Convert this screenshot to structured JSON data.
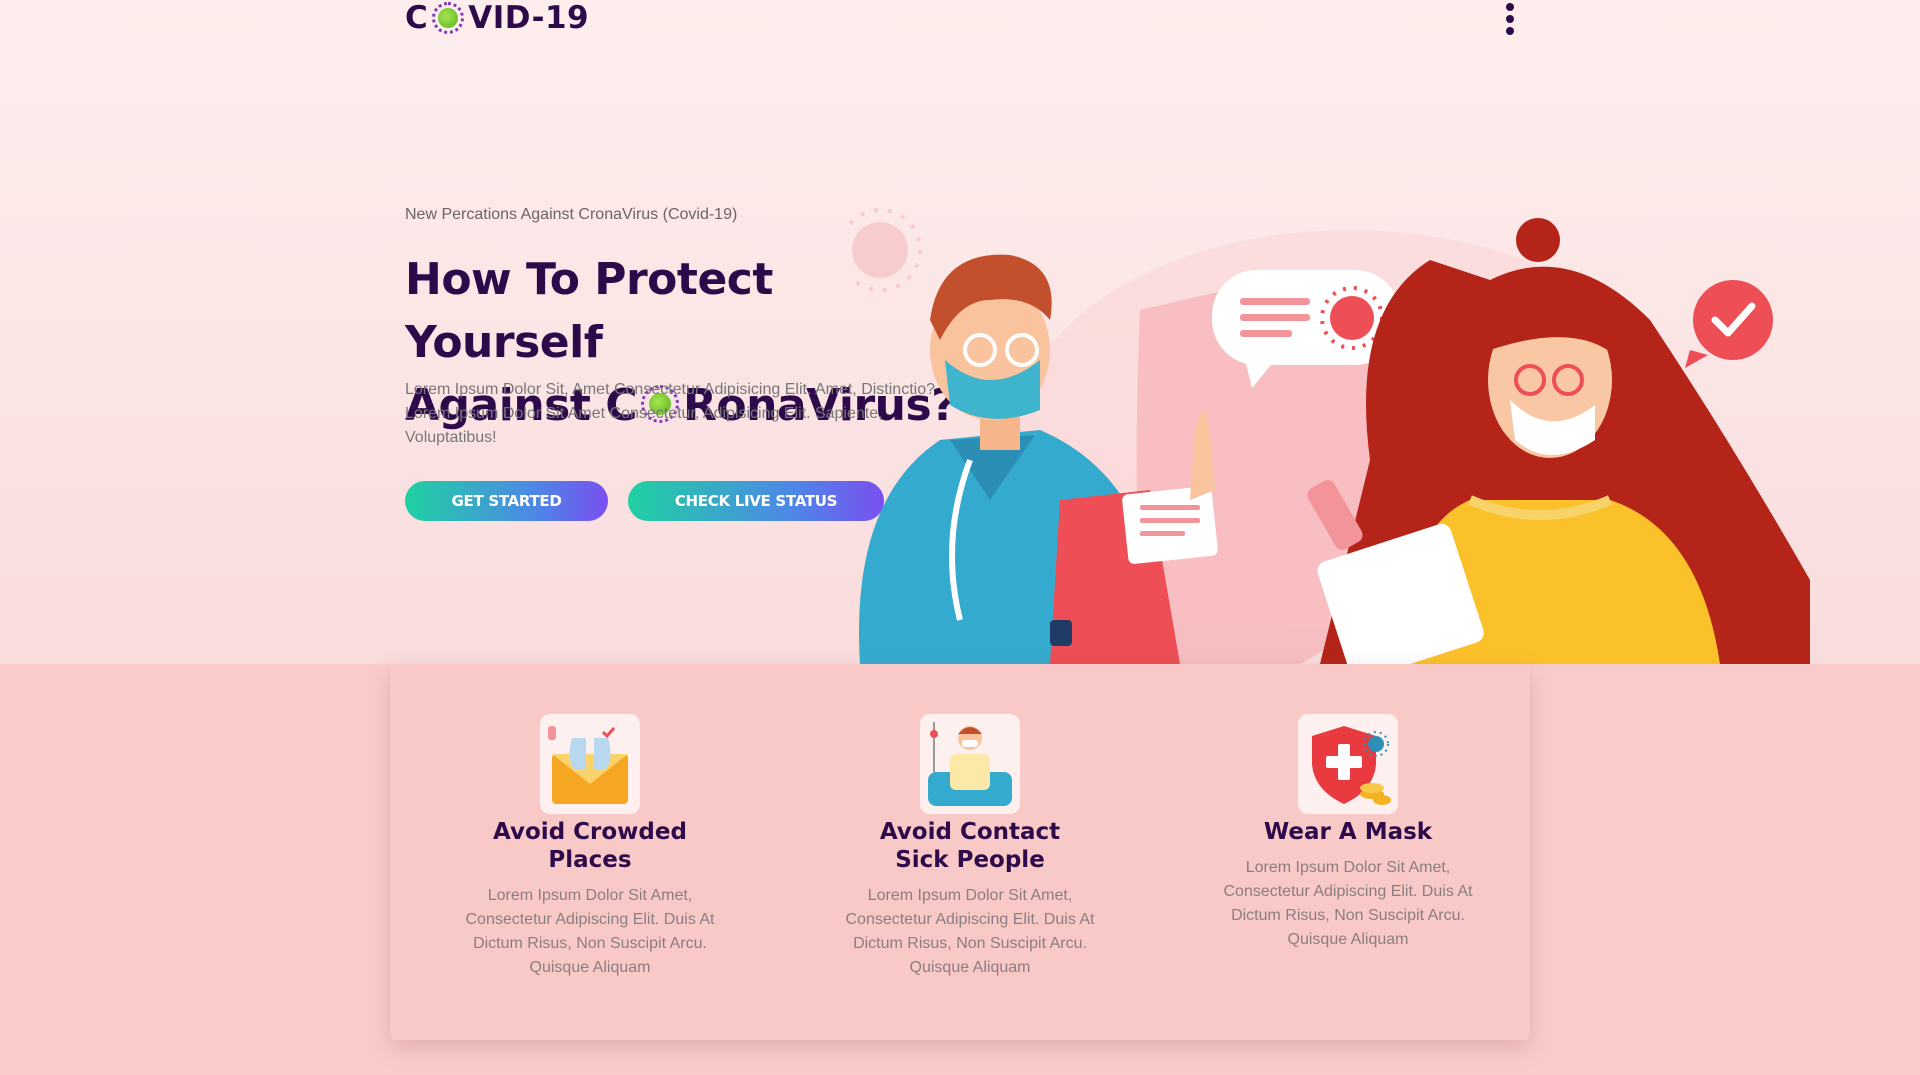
{
  "brand": {
    "logo_left": "C",
    "logo_right": "VID-19"
  },
  "hero": {
    "subtitle": "New Percations Against CronaVirus (Covid-19)",
    "title_line1": "How To Protect Yourself",
    "title_line2_left": "Against C",
    "title_line2_right": "RonaVirus?",
    "description": "Lorem Ipsum Dolor Sit, Amet Consectetur Adipisicing Elit. Amet, Distinctio? Lorem Ipsum Dolor Sit Amet Consectetur, Adipisicing Elit. Sapiente, Voluptatibus!",
    "btn_primary": "GET STARTED",
    "btn_secondary": "CHECK LIVE STATUS"
  },
  "cards": [
    {
      "title": "Avoid Crowded Places",
      "text": "Lorem Ipsum Dolor Sit Amet, Consectetur Adipiscing Elit. Duis At Dictum Risus, Non Suscipit Arcu. Quisque Aliquam",
      "icon": "envelope-lungs-icon"
    },
    {
      "title": "Avoid Contact Sick People",
      "text": "Lorem Ipsum Dolor Sit Amet, Consectetur Adipiscing Elit. Duis At Dictum Risus, Non Suscipit Arcu. Quisque Aliquam",
      "icon": "sick-patient-icon"
    },
    {
      "title": "Wear A Mask",
      "text": "Lorem Ipsum Dolor Sit Amet, Consectetur Adipiscing Elit. Duis At Dictum Risus, Non Suscipit Arcu. Quisque Aliquam",
      "icon": "shield-cross-icon"
    }
  ],
  "colors": {
    "brand_text": "#2d0b4b",
    "button_gradient_start": "#1fd1a1",
    "button_gradient_end": "#7a4ff0",
    "panel_bg": "#f9c9c8",
    "virus_green": "#7cc73a"
  }
}
